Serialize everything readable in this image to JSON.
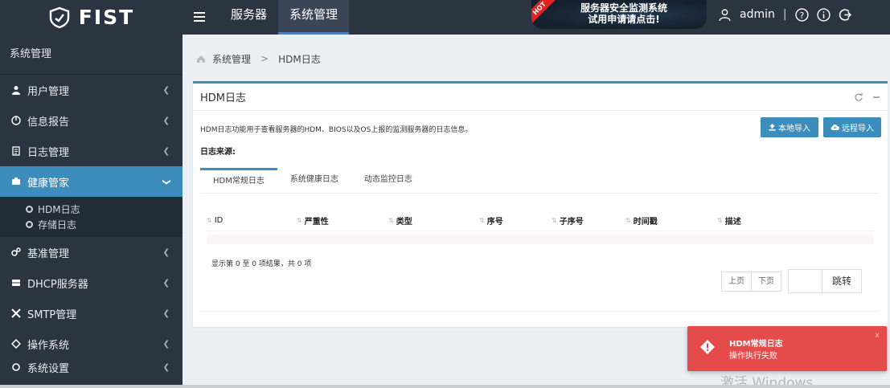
{
  "app": {
    "logo_text": "FIST"
  },
  "top_nav": {
    "items": [
      {
        "label": "服务器"
      },
      {
        "label": "系统管理"
      }
    ]
  },
  "promo": {
    "badge": "HOT",
    "line1": "服务器安全监测系统",
    "line2": "试用申请请点击!"
  },
  "user": {
    "name": "admin",
    "separator": "|"
  },
  "sidebar": {
    "title": "系统管理",
    "items": [
      {
        "label": "用户管理",
        "icon": "user-icon"
      },
      {
        "label": "信息报告",
        "icon": "report-icon"
      },
      {
        "label": "日志管理",
        "icon": "log-icon"
      },
      {
        "label": "健康管家",
        "icon": "health-icon"
      },
      {
        "label": "基准管理",
        "icon": "gears-icon"
      },
      {
        "label": "DHCP服务器",
        "icon": "server-icon"
      },
      {
        "label": "SMTP管理",
        "icon": "tools-icon"
      },
      {
        "label": "操作系统",
        "icon": "os-icon"
      },
      {
        "label": "系统设置",
        "icon": "settings-icon"
      }
    ],
    "sub_items": [
      {
        "label": "HDM日志"
      },
      {
        "label": "存储日志"
      }
    ]
  },
  "breadcrumb": {
    "root": "系统管理",
    "sep": ">",
    "current": "HDM日志"
  },
  "panel": {
    "title": "HDM日志",
    "description": "HDM日志功能用于查看服务器的HDM、BIOS以及OS上报的监测服务器的日志信息。",
    "source_label": "日志来源:",
    "buttons": {
      "local_import": "本地导入",
      "remote_import": "远程导入"
    },
    "tabs": [
      {
        "label": "HDM常规日志"
      },
      {
        "label": "系统健康日志"
      },
      {
        "label": "动态监控日志"
      }
    ],
    "columns": [
      "ID",
      "严重性",
      "类型",
      "序号",
      "子序号",
      "时间戳",
      "描述"
    ],
    "summary": "显示第 0 至 0 项结果，共 0 项",
    "pager": {
      "prev": "上页",
      "next": "下页",
      "go": "跳转"
    }
  },
  "toast": {
    "title": "HDM常规日志",
    "message": "操作执行失败",
    "close": "x"
  },
  "watermark": "激活 Windows",
  "colors": {
    "topbar": "#2b3542",
    "accent": "#3c8dbc",
    "toast": "#e54b4b"
  }
}
